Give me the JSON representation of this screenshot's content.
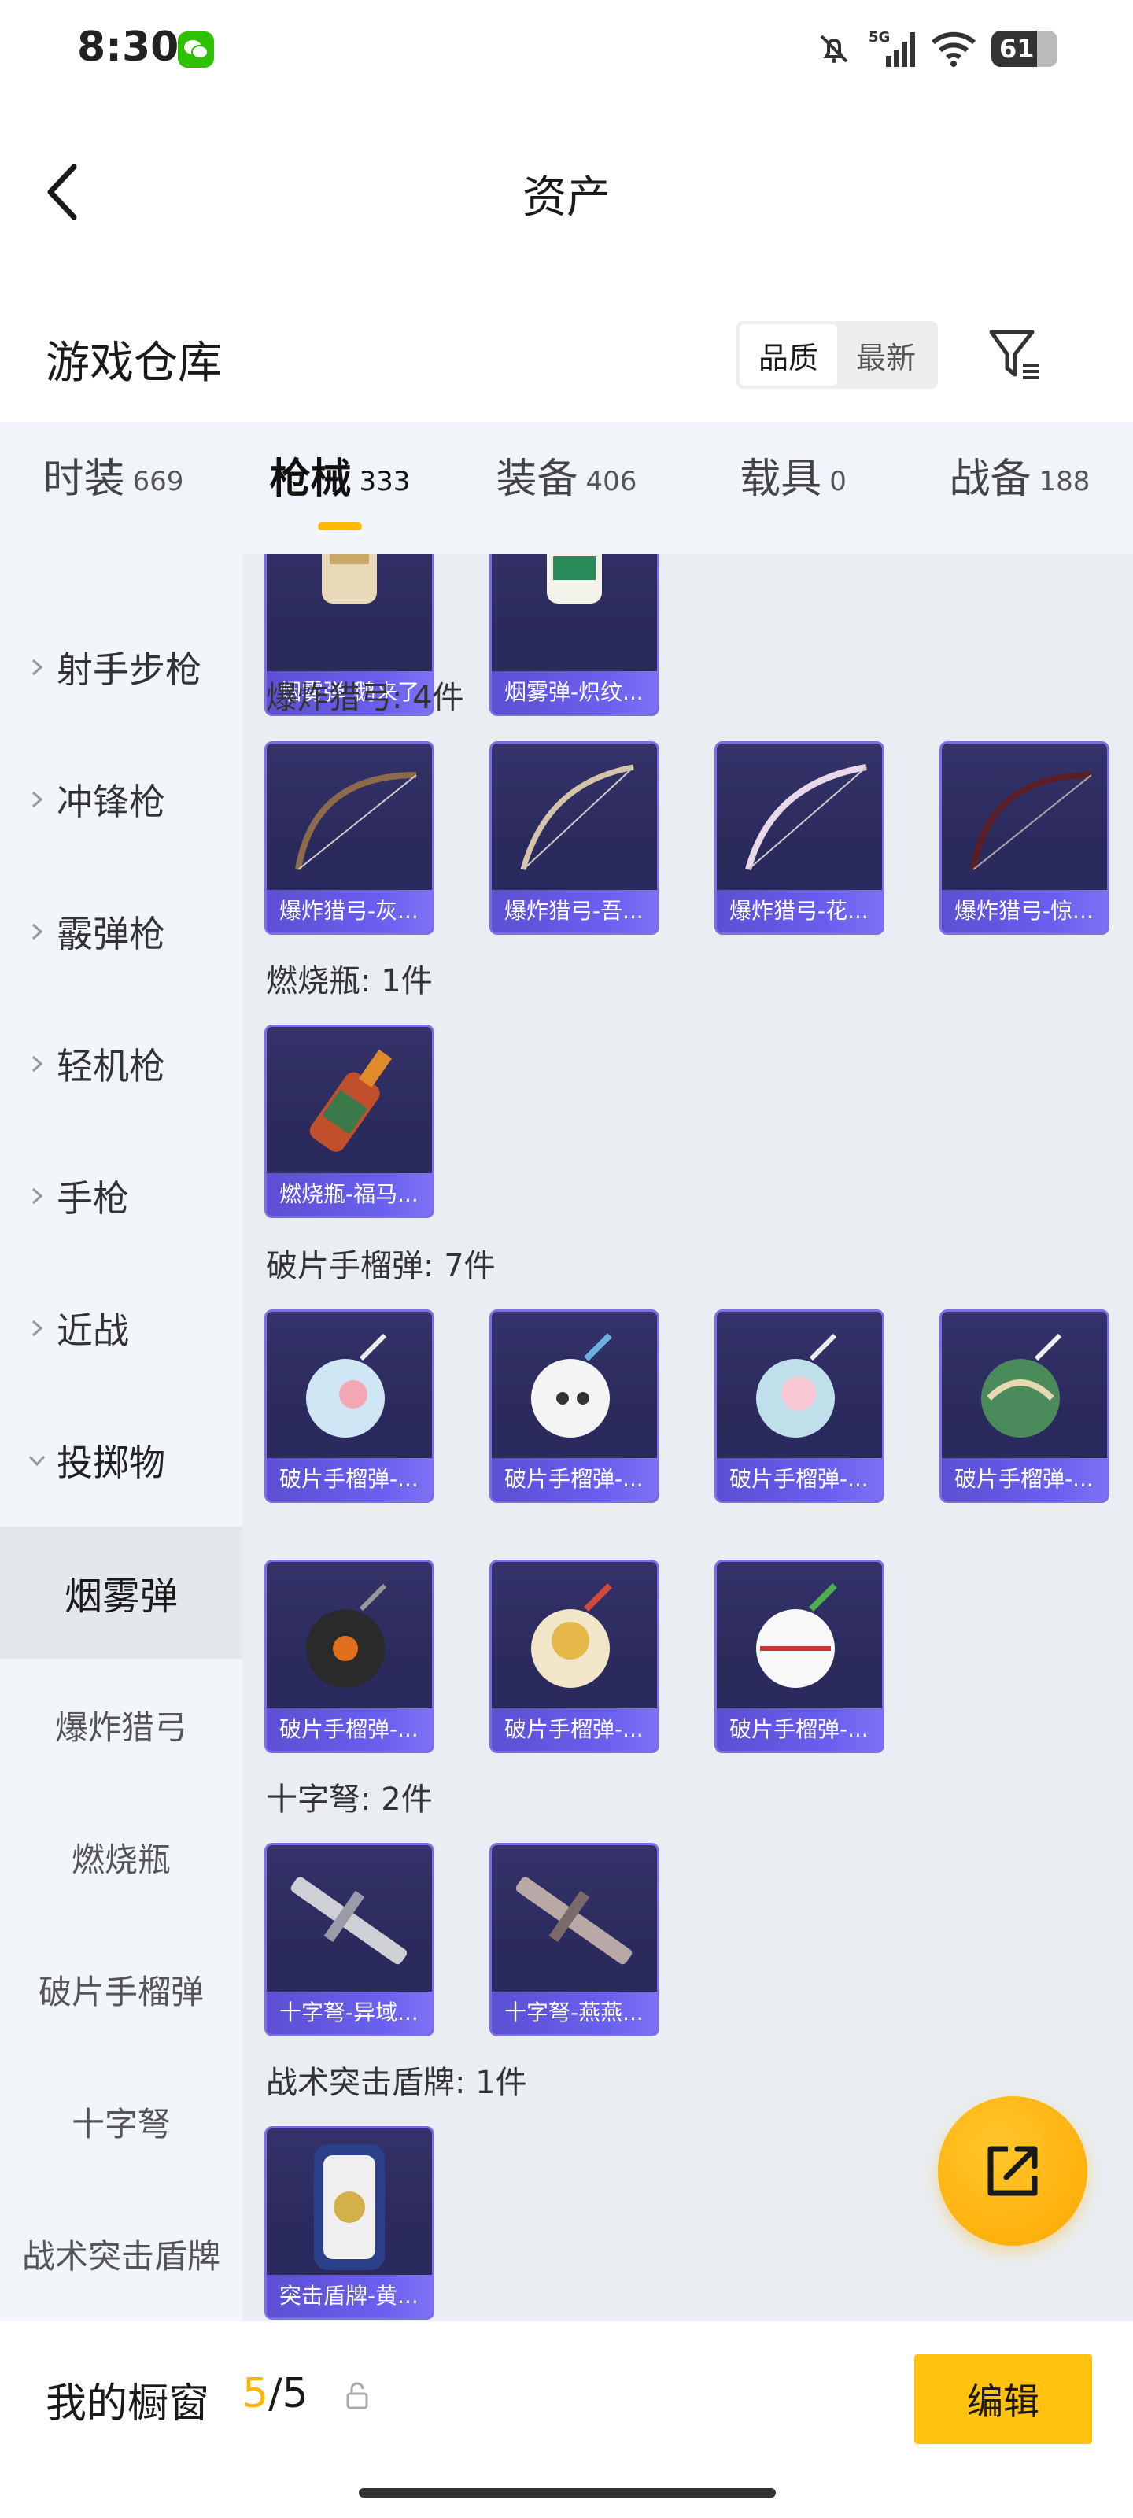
{
  "status_bar": {
    "time": "8:30",
    "network": "5G",
    "battery": "61",
    "icons": [
      "wechat-icon",
      "mute-bell-icon",
      "signal-icon",
      "wifi-icon",
      "battery-icon"
    ]
  },
  "header": {
    "title": "资产",
    "back_icon": "chevron-left-icon"
  },
  "warehouse": {
    "title": "游戏仓库",
    "sort_options": [
      "品质",
      "最新"
    ],
    "active_sort": "品质",
    "filter_icon": "filter-icon"
  },
  "tabs": [
    {
      "label": "时装",
      "count": "669"
    },
    {
      "label": "枪械",
      "count": "333",
      "active": true
    },
    {
      "label": "装备",
      "count": "406"
    },
    {
      "label": "载具",
      "count": "0"
    },
    {
      "label": "战备",
      "count": "188"
    }
  ],
  "sidebar": {
    "groups": [
      "射手步枪",
      "冲锋枪",
      "霰弹枪",
      "轻机枪",
      "手枪",
      "近战",
      "投掷物"
    ],
    "expanded_group": "投掷物",
    "subitems": [
      "烟雾弹",
      "爆炸猎弓",
      "燃烧瓶",
      "破片手榴弹",
      "十字弩",
      "战术突击盾牌"
    ],
    "active_subitem": "烟雾弹"
  },
  "content": {
    "sections": [
      {
        "title": "",
        "items": [
          "烟雾弹-鹅来了",
          "烟雾弹-炽纹..."
        ]
      },
      {
        "title": "爆炸猎弓: 4件",
        "items": [
          "爆炸猎弓-灰...",
          "爆炸猎弓-吾...",
          "爆炸猎弓-花...",
          "爆炸猎弓-惊..."
        ]
      },
      {
        "title": "燃烧瓶: 1件",
        "items": [
          "燃烧瓶-福马..."
        ]
      },
      {
        "title": "破片手榴弹: 7件",
        "items": [
          "破片手榴弹-...",
          "破片手榴弹-...",
          "破片手榴弹-...",
          "破片手榴弹-...",
          "破片手榴弹-...",
          "破片手榴弹-...",
          "破片手榴弹-..."
        ]
      },
      {
        "title": "十字弩: 2件",
        "items": [
          "十字弩-异域...",
          "十字弩-燕燕..."
        ]
      },
      {
        "title": "战术突击盾牌: 1件",
        "items": [
          "突击盾牌-黄..."
        ]
      }
    ]
  },
  "fab": {
    "icon": "share-external-icon"
  },
  "bottom_bar": {
    "showcase_label": "我的橱窗",
    "showcase_used": "5",
    "showcase_total": "/5",
    "lock_icon": "lock-icon",
    "edit_label": "编辑"
  },
  "colors": {
    "accent": "#ffb800",
    "card_caption": "#6b5ff0",
    "card_bg": "#2d2c60"
  }
}
